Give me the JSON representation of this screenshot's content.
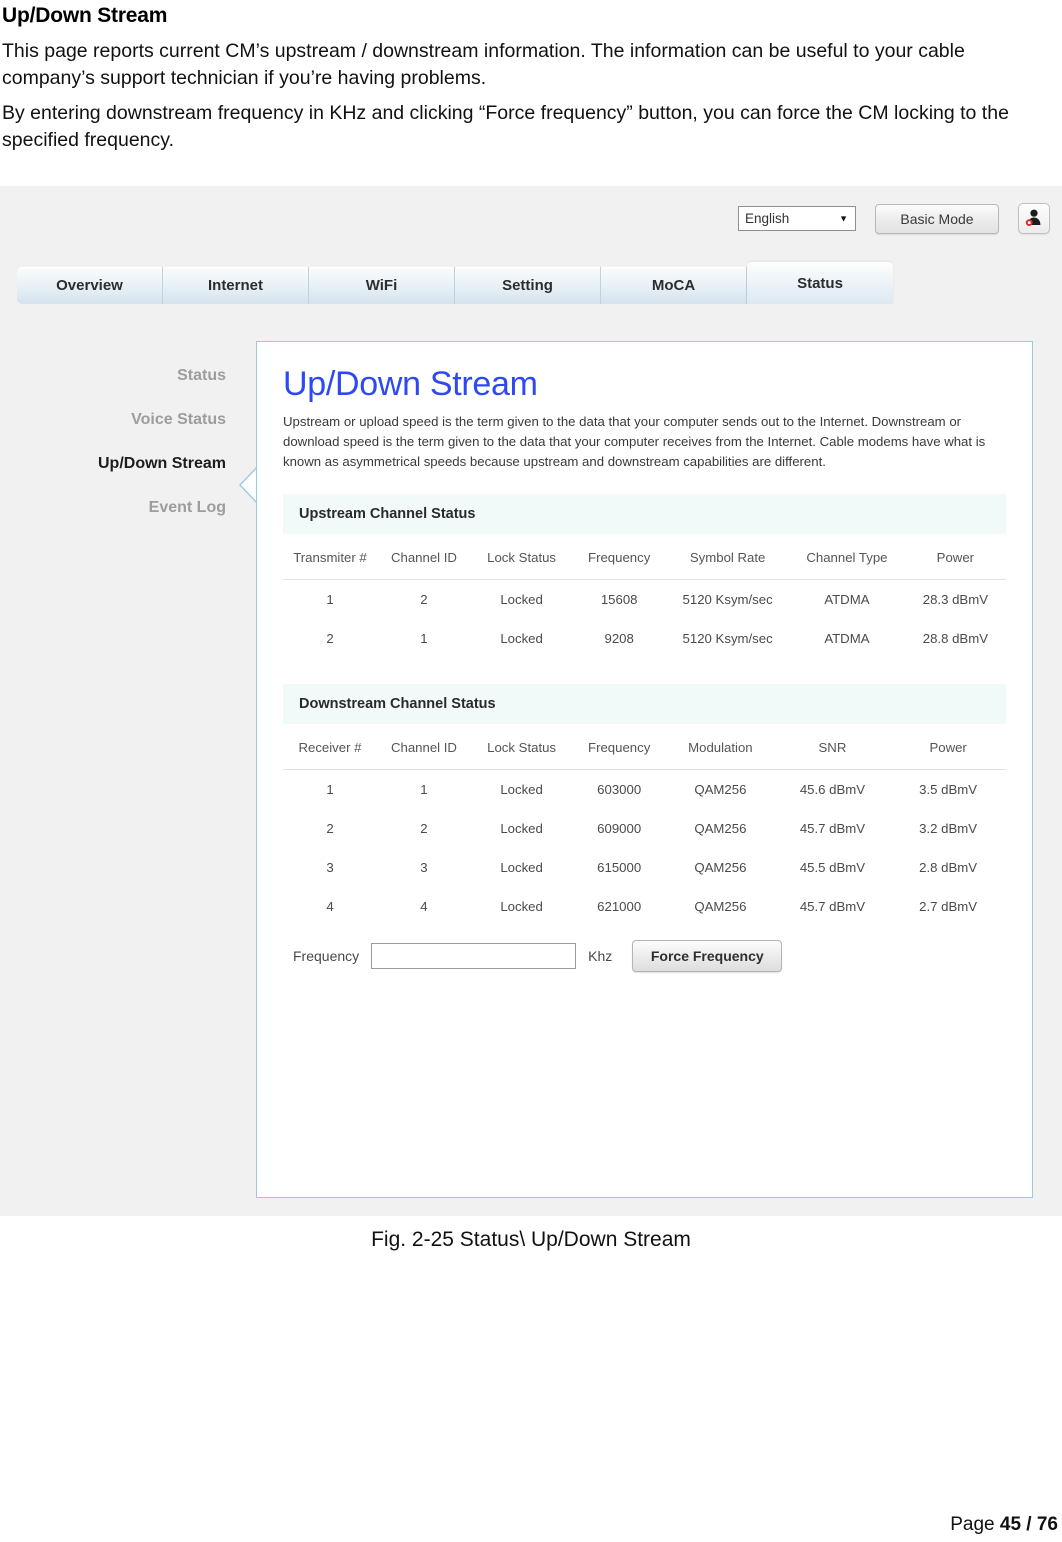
{
  "document": {
    "heading": "Up/Down Stream",
    "paragraphs": [
      "This page reports current CM’s upstream / downstream information. The information can be useful to your cable company’s support technician if you’re having problems.",
      "By entering downstream frequency in KHz and clicking “Force frequency” button, you can force the CM locking to the specified frequency."
    ],
    "figure_caption": "Fig. 2-25 Status\\ Up/Down Stream",
    "footer": {
      "prefix": "Page ",
      "page": "45 / 76"
    }
  },
  "screenshot": {
    "topbar": {
      "language_value": "English",
      "language_caret": "▼",
      "mode_button": "Basic Mode",
      "user_icon": "user-logout-icon"
    },
    "tabs": [
      {
        "label": "Overview",
        "active": false
      },
      {
        "label": "Internet",
        "active": false
      },
      {
        "label": "WiFi",
        "active": false
      },
      {
        "label": "Setting",
        "active": false
      },
      {
        "label": "MoCA",
        "active": false
      },
      {
        "label": "Status",
        "active": true
      }
    ],
    "sidebar": [
      {
        "label": "Status",
        "active": false
      },
      {
        "label": "Voice Status",
        "active": false
      },
      {
        "label": "Up/Down Stream",
        "active": true
      },
      {
        "label": "Event Log",
        "active": false
      }
    ],
    "panel": {
      "title": "Up/Down Stream",
      "description": "Upstream or upload speed is the term given to the data that your computer sends out to the Internet. Downstream or download speed is the term given to the data that your computer receives from the Internet. Cable modems have what is known as asymmetrical speeds because upstream and downstream capabilities are different.",
      "title_color": "#2e49f2",
      "border_color": "#9cc9dc"
    },
    "upstream": {
      "section_title": "Upstream Channel Status",
      "columns": [
        "Transmiter #",
        "Channel ID",
        "Lock Status",
        "Frequency",
        "Symbol Rate",
        "Channel Type",
        "Power"
      ],
      "rows": [
        [
          "1",
          "2",
          "Locked",
          "15608",
          "5120 Ksym/sec",
          "ATDMA",
          "28.3 dBmV"
        ],
        [
          "2",
          "1",
          "Locked",
          "9208",
          "5120 Ksym/sec",
          "ATDMA",
          "28.8 dBmV"
        ]
      ]
    },
    "downstream": {
      "section_title": "Downstream Channel Status",
      "columns": [
        "Receiver #",
        "Channel ID",
        "Lock Status",
        "Frequency",
        "Modulation",
        "SNR",
        "Power"
      ],
      "rows": [
        [
          "1",
          "1",
          "Locked",
          "603000",
          "QAM256",
          "45.6 dBmV",
          "3.5 dBmV"
        ],
        [
          "2",
          "2",
          "Locked",
          "609000",
          "QAM256",
          "45.7 dBmV",
          "3.2 dBmV"
        ],
        [
          "3",
          "3",
          "Locked",
          "615000",
          "QAM256",
          "45.5 dBmV",
          "2.8 dBmV"
        ],
        [
          "4",
          "4",
          "Locked",
          "621000",
          "QAM256",
          "45.7 dBmV",
          "2.7 dBmV"
        ]
      ]
    },
    "frequency_form": {
      "label": "Frequency",
      "value": "",
      "placeholder": "",
      "unit": "Khz",
      "button": "Force Frequency"
    }
  }
}
